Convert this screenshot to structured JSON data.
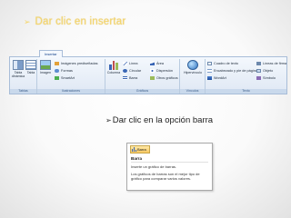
{
  "slide": {
    "title": "Dar clic en insertar",
    "bullet": "Dar clic en la opción  barra"
  },
  "ribbon": {
    "active_tab": "Insertar",
    "groups": {
      "tablas": {
        "label": "Tablas",
        "buttons": [
          "Tabla dinámica",
          "Tabla"
        ]
      },
      "ilustraciones": {
        "label": "Ilustraciones",
        "big_button": "Imagen",
        "small_buttons": [
          "Imágenes prediseñadas",
          "Formas",
          "SmartArt"
        ]
      },
      "graficos": {
        "label": "Gráficos",
        "big_button": "Columna",
        "small_buttons": [
          "Línea",
          "Área",
          "Circular",
          "Dispersión",
          "Barra",
          "Otros gráficos"
        ]
      },
      "vinculos": {
        "label": "Vínculos",
        "big_button": "Hipervínculo"
      },
      "texto": {
        "label": "Texto",
        "small_buttons": [
          "Cuadro de texto",
          "Líneas de firma",
          "Encabezado y pie de página",
          "Objeto",
          "WordArt",
          "Símbolo"
        ]
      }
    }
  },
  "tooltip": {
    "button_label": "Barra",
    "title": "Barra",
    "description_lines": [
      "Inserte un gráfico de barras.",
      "Los gráficos de barras son el mejor tipo de",
      "gráfico para comparar varios valores."
    ]
  },
  "colors": {
    "title": "#f6d66a",
    "ribbon_bg": "#dfe8f4",
    "ribbon_border": "#a8bdd8",
    "highlight": "#f8c860",
    "bar_blue": "#3a66b5"
  }
}
